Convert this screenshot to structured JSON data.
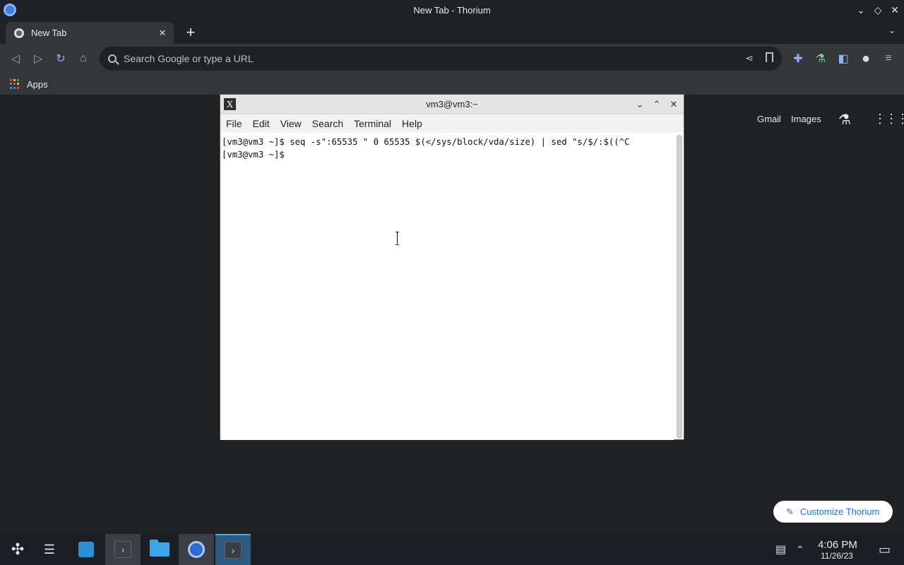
{
  "window": {
    "title": "New Tab - Thorium",
    "controls": [
      "minimize",
      "restore",
      "close"
    ]
  },
  "tabs": [
    {
      "label": "New Tab",
      "active": true
    }
  ],
  "toolbar": {
    "omnibox_placeholder": "Search Google or type a URL"
  },
  "bookmarks": {
    "apps_label": "Apps"
  },
  "ntp": {
    "gmail_label": "Gmail",
    "images_label": "Images",
    "customize_label": "Customize Thorium"
  },
  "terminal": {
    "title": "vm3@vm3:~",
    "menu": [
      "File",
      "Edit",
      "View",
      "Search",
      "Terminal",
      "Help"
    ],
    "lines": [
      "[vm3@vm3 ~]$ seq -s\":65535 \" 0 65535 $(</sys/block/vda/size) | sed \"s/$/:$((^C",
      "[vm3@vm3 ~]$"
    ]
  },
  "taskbar": {
    "time": "4:06 PM",
    "date": "11/26/23"
  },
  "colors": {
    "browser_bg": "#202124",
    "toolbar_bg": "#35363a",
    "accent_blue": "#1a73e8",
    "taskbar_bg": "#1b1f24"
  }
}
